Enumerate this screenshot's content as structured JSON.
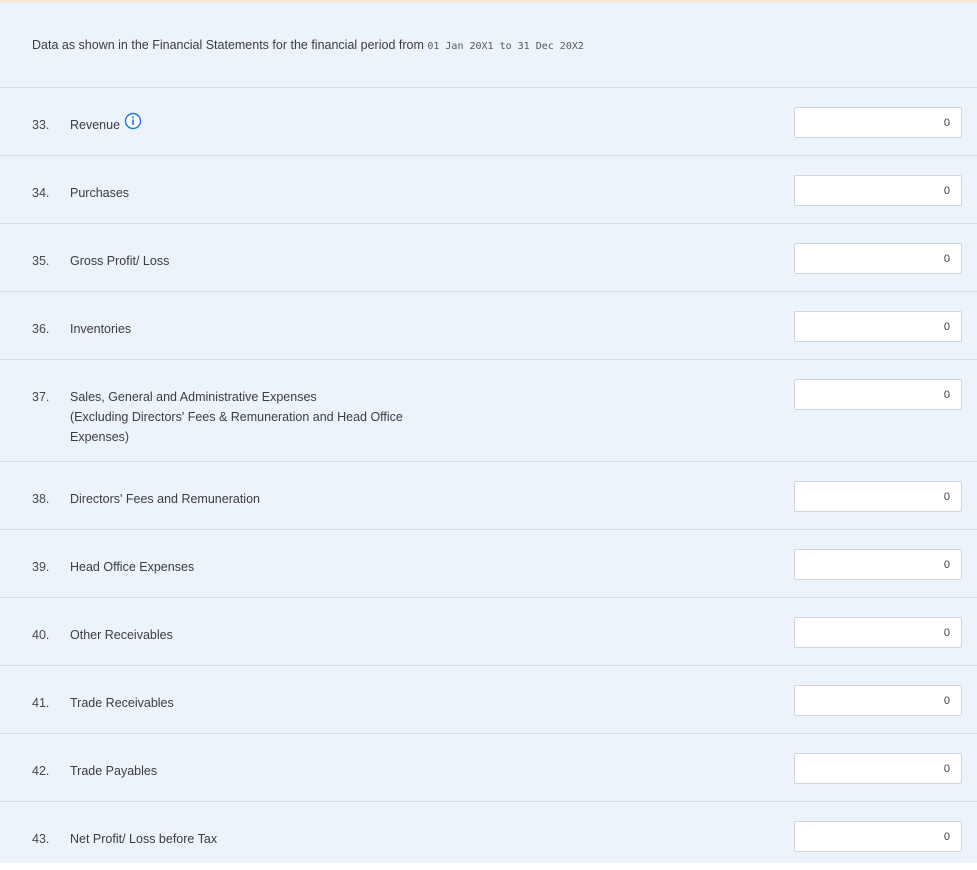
{
  "header": {
    "text": "Data as shown in the Financial Statements for the financial period from ",
    "period": "01 Jan 20X1 to 31 Dec 20X2"
  },
  "fields": [
    {
      "number": "33.",
      "label": "Revenue",
      "value": "0"
    },
    {
      "number": "34.",
      "label": "Purchases",
      "value": "0"
    },
    {
      "number": "35.",
      "label": "Gross Profit/ Loss",
      "value": "0"
    },
    {
      "number": "36.",
      "label": "Inventories",
      "value": "0"
    },
    {
      "number": "37.",
      "label": "Sales, General and Administrative Expenses",
      "sublabel": "(Excluding Directors' Fees & Remuneration and Head Office",
      "sublabel2": "Expenses)",
      "value": "0"
    },
    {
      "number": "38.",
      "label": "Directors' Fees and Remuneration",
      "value": "0"
    },
    {
      "number": "39.",
      "label": "Head Office Expenses",
      "value": "0"
    },
    {
      "number": "40.",
      "label": "Other Receivables",
      "value": "0"
    },
    {
      "number": "41.",
      "label": "Trade Receivables",
      "value": "0"
    },
    {
      "number": "42.",
      "label": "Trade Payables",
      "value": "0"
    },
    {
      "number": "43.",
      "label": "Net Profit/ Loss before Tax",
      "value": "0"
    }
  ],
  "icons": {
    "info": "info-icon",
    "info_color": "#1a73e8"
  }
}
